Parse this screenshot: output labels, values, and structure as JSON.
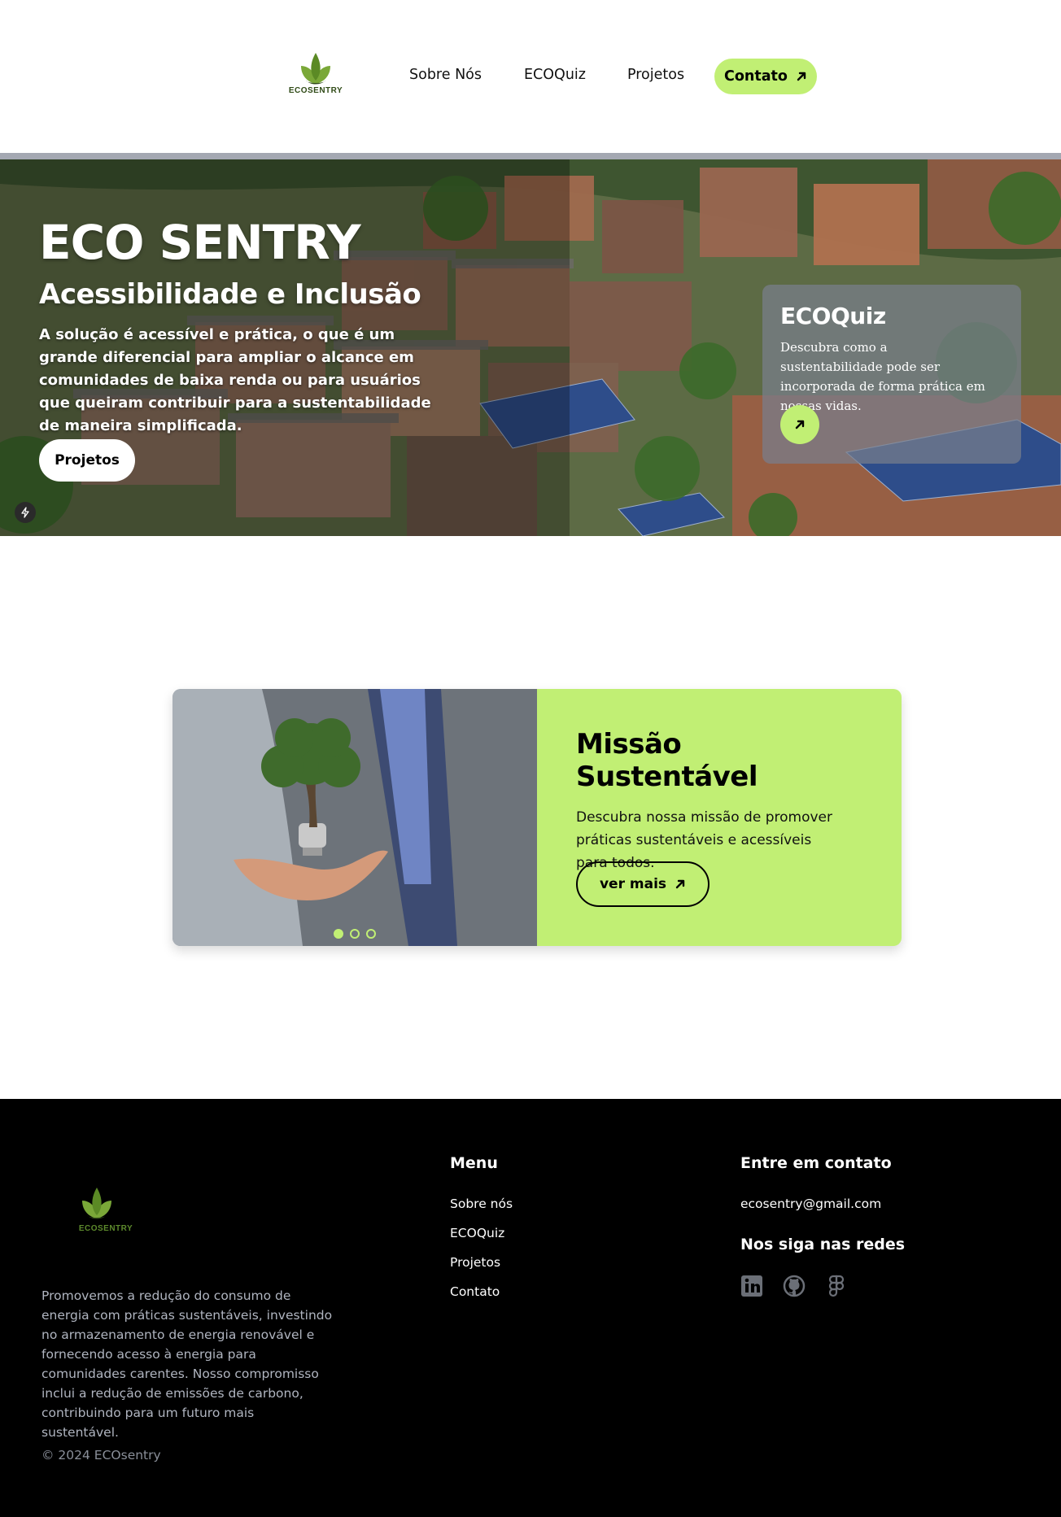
{
  "header": {
    "logo_text": "ECOSENTRY",
    "nav": [
      "Sobre Nós",
      "ECOQuiz",
      "Projetos"
    ],
    "contact_label": "Contato"
  },
  "hero": {
    "title": "ECO SENTRY",
    "subtitle": "Acessibilidade e Inclusão",
    "text": "A solução é acessível e prática, o que é um grande diferencial para ampliar o alcance em comunidades de baixa renda ou para usuários que queiram contribuir para a sustentabilidade de maneira simplificada.",
    "button_label": "Projetos"
  },
  "quiz_card": {
    "title": "ECOQuiz",
    "text": "Descubra como a sustentabilidade pode ser incorporada de forma prática em nossas vidas."
  },
  "mission": {
    "title": "Missão Sustentável",
    "text": "Descubra nossa missão de promover práticas sustentáveis e acessíveis para todos.",
    "button_label": "ver mais",
    "slides": 3,
    "active_slide": 1
  },
  "footer": {
    "logo_text": "ECOSENTRY",
    "description": "Promovemos a redução do consumo de energia com práticas sustentáveis, investindo no armazenamento de energia renovável e fornecendo acesso à energia para comunidades carentes. Nosso compromisso inclui a redução de emissões de carbono, contribuindo para um futuro mais sustentável.",
    "copyright": "© 2024 ECOsentry",
    "menu_heading": "Menu",
    "menu": [
      "Sobre nós",
      "ECOQuiz",
      "Projetos",
      "Contato"
    ],
    "contact_heading": "Entre em contato",
    "email": "ecosentry@gmail.com",
    "social_heading": "Nos siga nas redes",
    "social_icons": [
      "linkedin-icon",
      "github-icon",
      "figma-icon"
    ]
  },
  "colors": {
    "accent": "#c1ef74",
    "footer_bg": "#000000",
    "logo_green": "#5d8a2c"
  }
}
